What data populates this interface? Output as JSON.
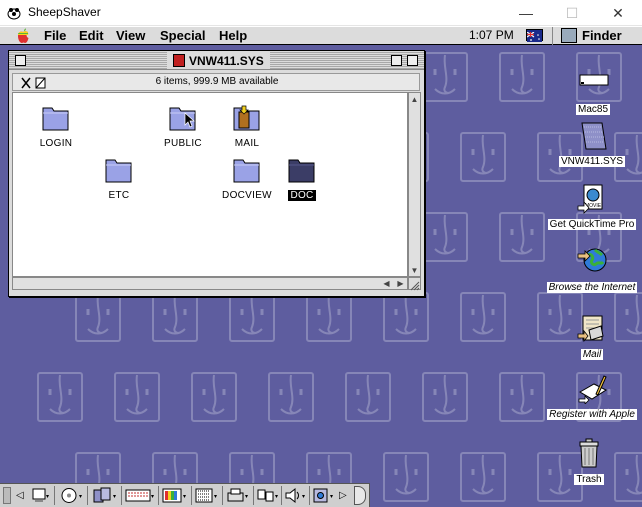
{
  "host_window": {
    "title": "SheepShaver",
    "icon": "sheepshaver-icon",
    "controls": {
      "minimize": "—",
      "maximize": "☐",
      "close": "✕"
    }
  },
  "menubar": {
    "items": [
      "File",
      "Edit",
      "View",
      "Special",
      "Help"
    ],
    "clock": "1:07 PM",
    "app_label": "Finder"
  },
  "finder_window": {
    "title": "VNW411.SYS",
    "status": "6 items, 999.9 MB available",
    "items": [
      {
        "label": "LOGIN",
        "icon": "folder-icon",
        "selected": false
      },
      {
        "label": "PUBLIC",
        "icon": "folder-icon",
        "selected": false
      },
      {
        "label": "MAIL",
        "icon": "mail-folder-icon",
        "selected": false
      },
      {
        "label": "ETC",
        "icon": "folder-icon",
        "selected": false
      },
      {
        "label": "DOCVIEW",
        "icon": "folder-icon",
        "selected": false
      },
      {
        "label": "DOC",
        "icon": "folder-icon",
        "selected": true
      }
    ]
  },
  "desktop_icons": [
    {
      "label": "Mac85",
      "icon": "disk-icon"
    },
    {
      "label": "VNW411.SYS",
      "icon": "volume-icon"
    },
    {
      "label": "Get QuickTime Pro",
      "icon": "quicktime-icon"
    },
    {
      "label": "Browse the Internet",
      "icon": "globe-icon"
    },
    {
      "label": "Mail",
      "icon": "mail-icon"
    },
    {
      "label": "Register with Apple",
      "icon": "register-icon"
    },
    {
      "label": "Trash",
      "icon": "trash-icon"
    }
  ],
  "colors": {
    "desktop": "#5e5d9f",
    "selection": "#000000"
  }
}
